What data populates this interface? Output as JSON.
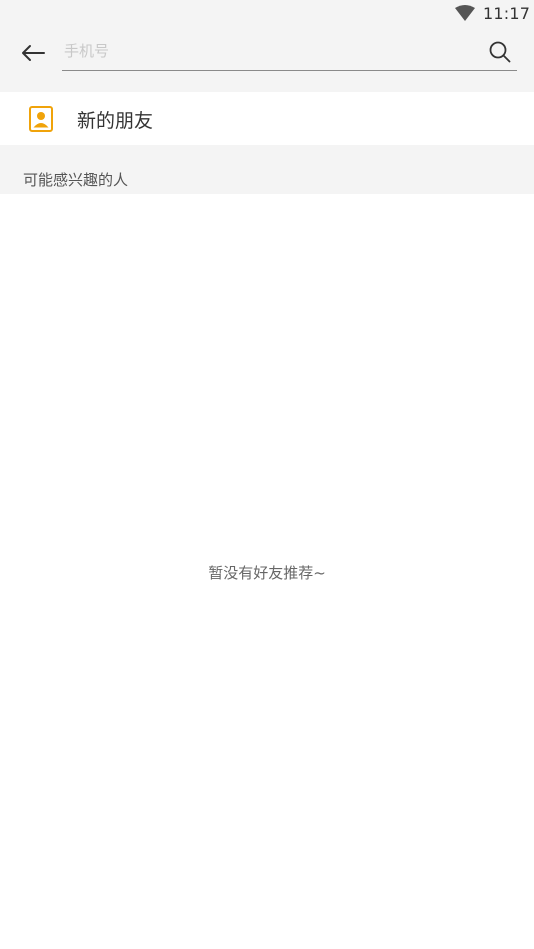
{
  "status_bar": {
    "time": "11:17",
    "wifi_icon": "wifi-icon"
  },
  "toolbar": {
    "back_icon": "back-arrow-icon",
    "search_placeholder": "手机号",
    "search_value": "",
    "search_icon": "search-icon"
  },
  "new_friends": {
    "icon": "contact-icon",
    "label": "新的朋友",
    "icon_color": "#f0a30a"
  },
  "suggestions": {
    "title": "可能感兴趣的人",
    "empty_message": "暂没有好友推荐~"
  }
}
